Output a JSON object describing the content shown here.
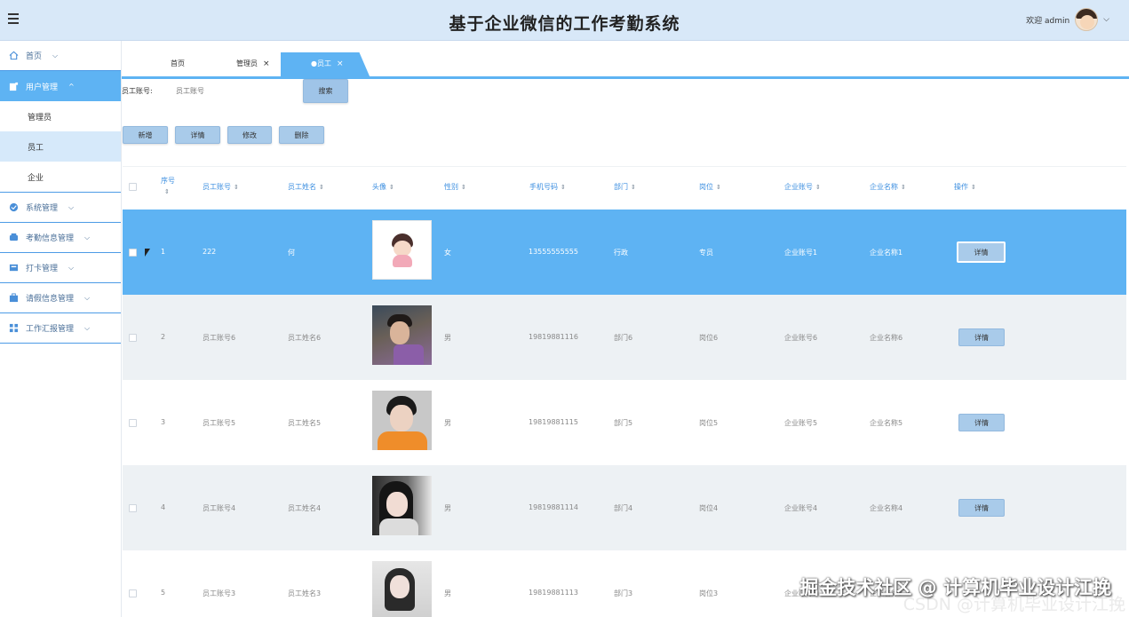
{
  "header": {
    "title": "基于企业微信的工作考勤系统",
    "welcome": "欢迎 admin",
    "menu_icon": "hamburger-icon",
    "user_chevron": "chevron-down-icon"
  },
  "sidebar": {
    "items": [
      {
        "label": "首页",
        "icon": "home-icon",
        "arrow": "⌵"
      },
      {
        "label": "用户管理",
        "icon": "user-manage-icon",
        "arrow": "^"
      },
      {
        "label": "系统管理",
        "icon": "system-icon",
        "arrow": "⌵"
      },
      {
        "label": "考勤信息管理",
        "icon": "attendance-icon",
        "arrow": "⌵"
      },
      {
        "label": "打卡管理",
        "icon": "clock-in-icon",
        "arrow": "⌵"
      },
      {
        "label": "请假信息管理",
        "icon": "leave-icon",
        "arrow": "⌵"
      },
      {
        "label": "工作汇报管理",
        "icon": "report-icon",
        "arrow": "⌵"
      }
    ],
    "subitems": [
      "管理员",
      "员工",
      "企业"
    ]
  },
  "tabs": [
    {
      "label": "首页",
      "close": ""
    },
    {
      "label": "管理员",
      "close": "×"
    },
    {
      "label": "●员工",
      "close": "×"
    }
  ],
  "search": {
    "label": "员工账号:",
    "placeholder": "员工账号",
    "button": "搜索"
  },
  "actions": {
    "add": "新增",
    "detail": "详情",
    "edit": "修改",
    "delete": "删除"
  },
  "table": {
    "columns": [
      "序号",
      "员工账号",
      "员工姓名",
      "头像",
      "性别",
      "手机号码",
      "部门",
      "岗位",
      "企业账号",
      "企业名称",
      "操作"
    ],
    "sort_glyph": "⇕",
    "detail_label": "详情",
    "rows": [
      {
        "seq": "1",
        "account": "222",
        "name": "何",
        "gender": "女",
        "phone": "13555555555",
        "dept": "行政",
        "post": "专员",
        "corp_account": "企业账号1",
        "corp_name": "企业名称1"
      },
      {
        "seq": "2",
        "account": "员工账号6",
        "name": "员工姓名6",
        "gender": "男",
        "phone": "19819881116",
        "dept": "部门6",
        "post": "岗位6",
        "corp_account": "企业账号6",
        "corp_name": "企业名称6"
      },
      {
        "seq": "3",
        "account": "员工账号5",
        "name": "员工姓名5",
        "gender": "男",
        "phone": "19819881115",
        "dept": "部门5",
        "post": "岗位5",
        "corp_account": "企业账号5",
        "corp_name": "企业名称5"
      },
      {
        "seq": "4",
        "account": "员工账号4",
        "name": "员工姓名4",
        "gender": "男",
        "phone": "19819881114",
        "dept": "部门4",
        "post": "岗位4",
        "corp_account": "企业账号4",
        "corp_name": "企业名称4"
      },
      {
        "seq": "5",
        "account": "员工账号3",
        "name": "员工姓名3",
        "gender": "男",
        "phone": "19819881113",
        "dept": "部门3",
        "post": "岗位3",
        "corp_account": "企业账号3",
        "corp_name": "企业名称3"
      }
    ]
  },
  "watermark": {
    "line1": "掘金技术社区 @ 计算机毕业设计江挽",
    "line2": "CSDN @计算机毕业设计江挽"
  },
  "colors": {
    "accent": "#5eb3f3",
    "header_bg": "#d8e8f8",
    "button_bg": "#a9cbea"
  }
}
